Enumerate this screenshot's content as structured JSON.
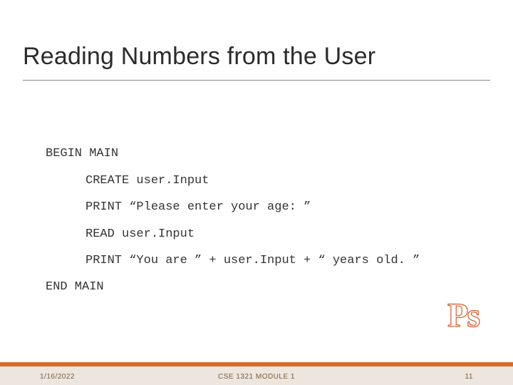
{
  "title": "Reading Numbers from the User",
  "code": {
    "l1": "BEGIN MAIN",
    "l2": "CREATE user.Input",
    "l3": "PRINT “Please enter your age: ”",
    "l4": "READ user.Input",
    "l5": "PRINT “You are ” + user.Input + “ years old. ”",
    "l6": "END MAIN"
  },
  "badge": "Ps",
  "footer": {
    "date": "1/16/2022",
    "center": "CSE 1321 MODULE 1",
    "page": "11"
  }
}
